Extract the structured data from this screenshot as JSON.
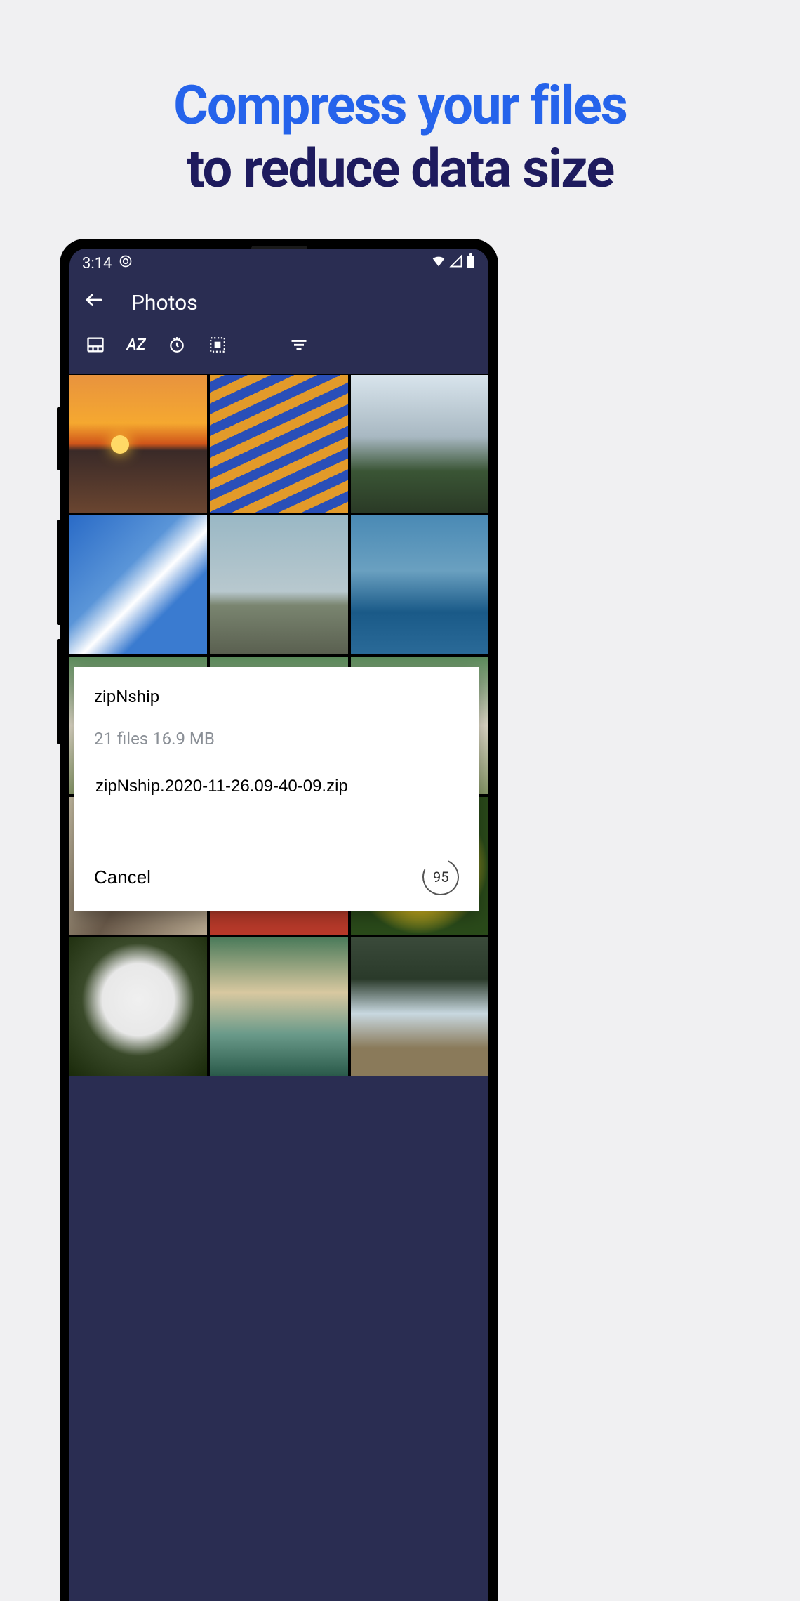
{
  "headline": {
    "line1": "Compress your files",
    "line2": "to reduce data size"
  },
  "status": {
    "time": "3:14"
  },
  "appbar": {
    "title": "Photos"
  },
  "toolbar": {
    "sort_az": "AZ"
  },
  "dialog": {
    "title": "zipNship",
    "info": "21 files 16.9 MB",
    "filename": "zipNship.2020-11-26.09-40-09.zip",
    "cancel": "Cancel",
    "progress": "95"
  }
}
